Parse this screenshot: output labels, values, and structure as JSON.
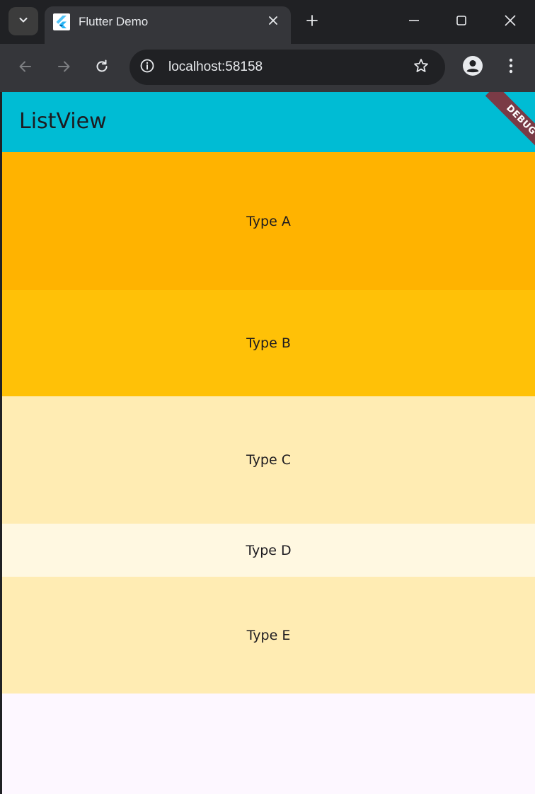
{
  "browser": {
    "tab": {
      "title": "Flutter Demo",
      "favicon": "flutter-logo"
    },
    "url": "localhost:58158",
    "icons": {
      "tab_search": "chevron-down-icon",
      "close_tab": "close-icon",
      "new_tab": "plus-icon",
      "minimize": "minimize-icon",
      "maximize": "maximize-icon",
      "close_window": "close-icon",
      "back": "arrow-left-icon",
      "forward": "arrow-right-icon",
      "reload": "reload-icon",
      "site_info": "info-icon",
      "bookmark": "star-icon",
      "profile": "profile-icon",
      "menu": "more-vertical-icon"
    },
    "colors": {
      "frame": "#202124",
      "toolbar": "#35363a"
    }
  },
  "app": {
    "appbar": {
      "title": "ListView",
      "color": "#00bcd4"
    },
    "debug_banner": "DEBUG",
    "list": {
      "items": [
        {
          "label": "Type A",
          "color": "#ffb300"
        },
        {
          "label": "Type B",
          "color": "#ffc107"
        },
        {
          "label": "Type C",
          "color": "#ffecb3"
        },
        {
          "label": "Type D",
          "color": "#fff8e1"
        },
        {
          "label": "Type E",
          "color": "#ffecb3"
        }
      ]
    },
    "background": "#fdf7ff"
  }
}
